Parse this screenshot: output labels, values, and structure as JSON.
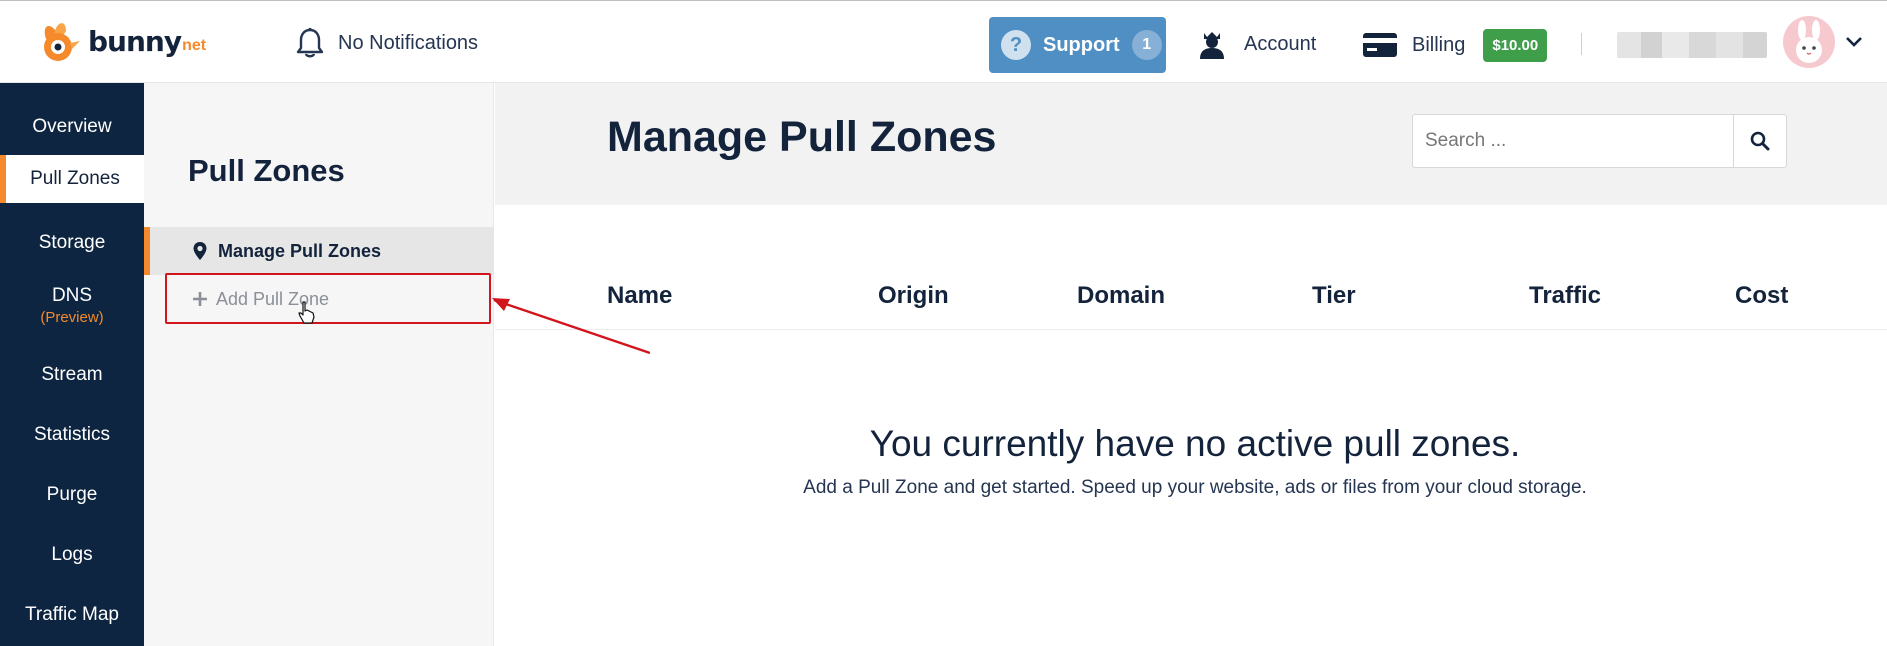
{
  "topbar": {
    "logo_text": "bunny",
    "logo_tld": "net",
    "notifications_label": "No Notifications",
    "support_label": "Support",
    "support_count": "1",
    "account_label": "Account",
    "billing_label": "Billing",
    "billing_balance": "$10.00",
    "icons": {
      "notifications": "bell-icon",
      "support": "question-circle-icon",
      "account": "user-icon",
      "billing": "credit-card-icon",
      "menu": "chevron-down-icon"
    }
  },
  "leftnav": {
    "items": [
      {
        "label": "Overview"
      },
      {
        "label": "Pull Zones"
      },
      {
        "label": "Storage"
      },
      {
        "label": "DNS",
        "sub": "(Preview)"
      },
      {
        "label": "Stream"
      },
      {
        "label": "Statistics"
      },
      {
        "label": "Purge"
      },
      {
        "label": "Logs"
      },
      {
        "label": "Traffic Map"
      }
    ],
    "active": "Pull Zones"
  },
  "subnav": {
    "title": "Pull Zones",
    "items": [
      {
        "label": "Manage Pull Zones",
        "icon": "map-marker-icon"
      },
      {
        "label": "Add Pull Zone",
        "icon": "plus-icon"
      }
    ]
  },
  "main": {
    "title": "Manage Pull Zones",
    "search_placeholder": "Search ...",
    "columns": [
      "Name",
      "Origin",
      "Domain",
      "Tier",
      "Traffic",
      "Cost"
    ],
    "empty_title": "You currently have no active pull zones.",
    "empty_subtitle": "Add a Pull Zone and get started. Speed up your website, ads or files from your cloud storage."
  },
  "colors": {
    "nav_bg": "#0d2540",
    "accent_orange": "#f48a2b",
    "support_blue": "#4f8fc3",
    "billing_green": "#3e9e4a",
    "annotation_red": "#d2141c"
  }
}
